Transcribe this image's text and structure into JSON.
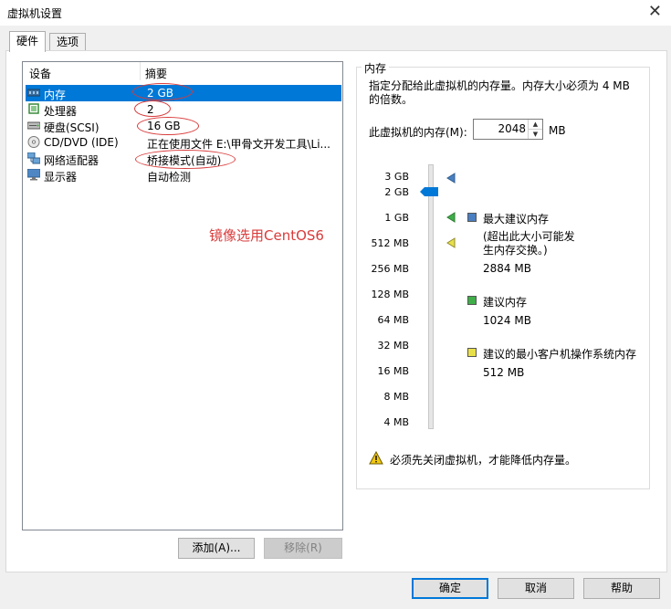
{
  "window": {
    "title": "虚拟机设置"
  },
  "tabs": [
    {
      "label": "硬件"
    },
    {
      "label": "选项"
    }
  ],
  "device_list": {
    "headers": {
      "device": "设备",
      "summary": "摘要"
    },
    "rows": [
      {
        "name": "内存",
        "summary": "2 GB",
        "icon": "memory-icon"
      },
      {
        "name": "处理器",
        "summary": "2",
        "icon": "processor-icon"
      },
      {
        "name": "硬盘(SCSI)",
        "summary": "16 GB",
        "icon": "harddisk-icon"
      },
      {
        "name": "CD/DVD (IDE)",
        "summary": "正在使用文件 E:\\甲骨文开发工具\\Li...",
        "icon": "cdrom-icon"
      },
      {
        "name": "网络适配器",
        "summary": "桥接模式(自动)",
        "icon": "network-icon"
      },
      {
        "name": "显示器",
        "summary": "自动检测",
        "icon": "display-icon"
      }
    ],
    "selected_index": 0
  },
  "annotation": {
    "text": "镜像选用CentOS6",
    "color": "#d93b3b"
  },
  "list_buttons": {
    "add": "添加(A)...",
    "remove": "移除(R)"
  },
  "memory_panel": {
    "group_title": "内存",
    "description": "指定分配给此虚拟机的内存量。内存大小必须为 4 MB 的倍数。",
    "memory_label": "此虚拟机的内存(M):",
    "memory_value": "2048",
    "memory_unit": "MB",
    "scale_labels": [
      "3 GB",
      "2 GB",
      "1 GB",
      "512 MB",
      "256 MB",
      "128 MB",
      "64 MB",
      "32 MB",
      "16 MB",
      "8 MB",
      "4 MB"
    ],
    "max_recommended": {
      "label": "最大建议内存",
      "note": "(超出此大小可能发生内存交换。)",
      "value": "2884 MB",
      "color": "#4a7fc1"
    },
    "recommended": {
      "label": "建议内存",
      "value": "1024 MB",
      "color": "#3fae49"
    },
    "min_guest": {
      "label": "建议的最小客户机操作系统内存",
      "value": "512 MB",
      "color": "#e8e04a"
    },
    "warning": "必须先关闭虚拟机，才能降低内存量。"
  },
  "footer_buttons": {
    "ok": "确定",
    "cancel": "取消",
    "help": "帮助"
  },
  "colors": {
    "selection": "#0078d7",
    "annotation": "#d93b3b"
  }
}
